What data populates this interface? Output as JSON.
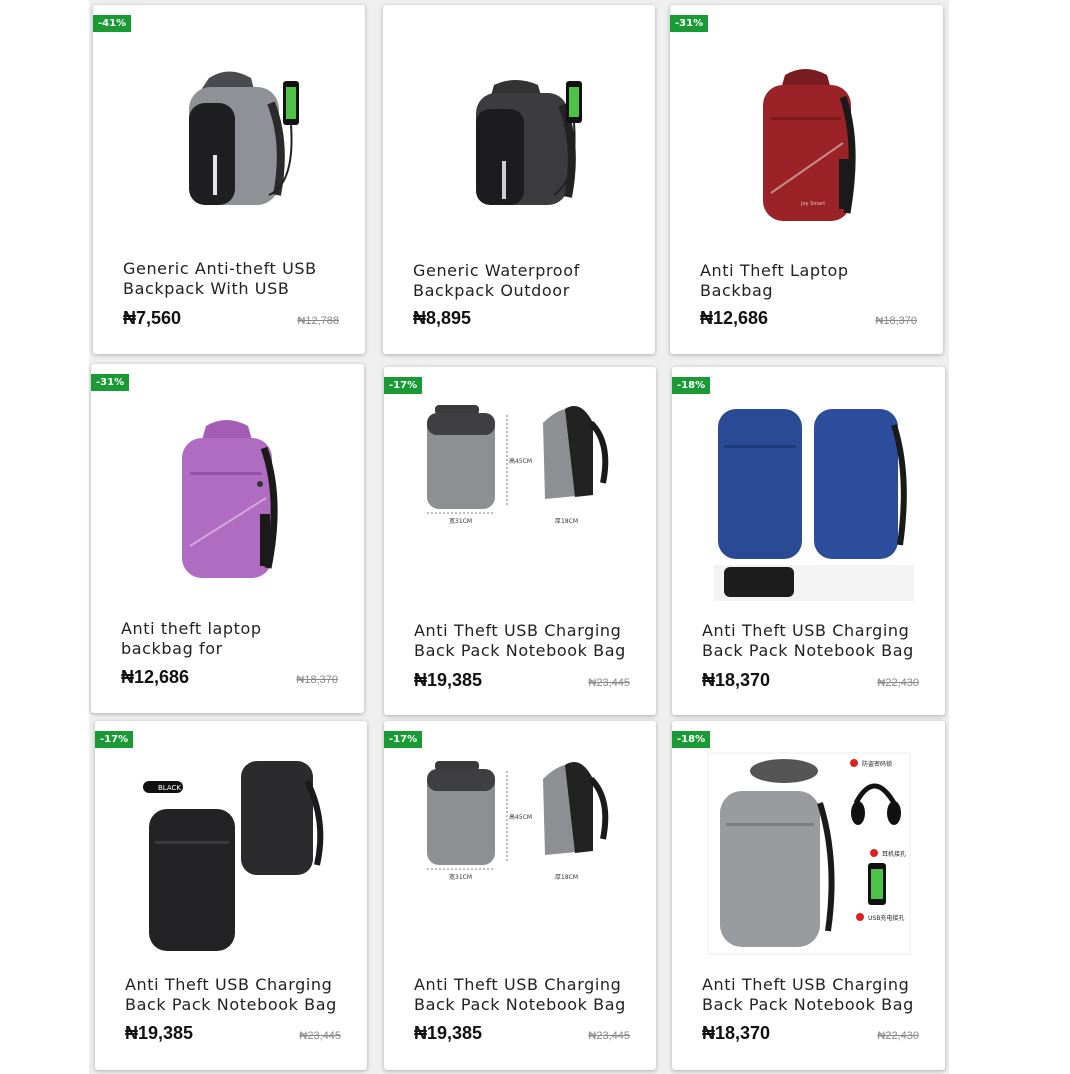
{
  "products": [
    {
      "badge": "-41%",
      "title_line1": "Generic Anti-theft USB",
      "title_line2": "Backpack With USB",
      "price": "₦7,560",
      "old_price": "₦12,788"
    },
    {
      "badge": "",
      "title_line1": "Generic Waterproof",
      "title_line2": "Backpack Outdoor",
      "price": "₦8,895",
      "old_price": ""
    },
    {
      "badge": "-31%",
      "title_line1": "Anti Theft Laptop",
      "title_line2": "Backbag",
      "price": "₦12,686",
      "old_price": "₦18,370"
    },
    {
      "badge": "-31%",
      "title_line1": "Anti theft laptop",
      "title_line2": "backbag for",
      "price": "₦12,686",
      "old_price": "₦18,370"
    },
    {
      "badge": "-17%",
      "title_line1": "Anti Theft USB Charging",
      "title_line2": "Back Pack Notebook Bag",
      "price": "₦19,385",
      "old_price": "₦23,445"
    },
    {
      "badge": "-18%",
      "title_line1": "Anti Theft USB Charging",
      "title_line2": "Back Pack Notebook Bag",
      "price": "₦18,370",
      "old_price": "₦22,430"
    },
    {
      "badge": "-17%",
      "title_line1": "Anti Theft USB Charging",
      "title_line2": "Back Pack Notebook Bag",
      "price": "₦19,385",
      "old_price": "₦23,445"
    },
    {
      "badge": "-17%",
      "title_line1": "Anti Theft USB Charging",
      "title_line2": "Back Pack Notebook Bag",
      "price": "₦19,385",
      "old_price": "₦23,445"
    },
    {
      "badge": "-18%",
      "title_line1": "Anti Theft USB Charging",
      "title_line2": "Back Pack Notebook Bag",
      "price": "₦18,370",
      "old_price": "₦22,430"
    }
  ],
  "image_labels": {
    "dim_height": "高45CM",
    "dim_width": "宽31CM",
    "dim_depth": "厚18CM",
    "color_tag": "BLACK",
    "feature_1": "防盗密码锁",
    "feature_2": "耳机接孔",
    "feature_3": "USB充电接孔",
    "brand_mark": "Joy Smart"
  },
  "colors": {
    "badge_green": "#1a9a34",
    "grey_bag": "#8e8f92",
    "dark_bag": "#2b2b2e",
    "red_bag": "#9b2226",
    "purple_bag": "#b06cc0",
    "blue_bag": "#2a4a96"
  }
}
